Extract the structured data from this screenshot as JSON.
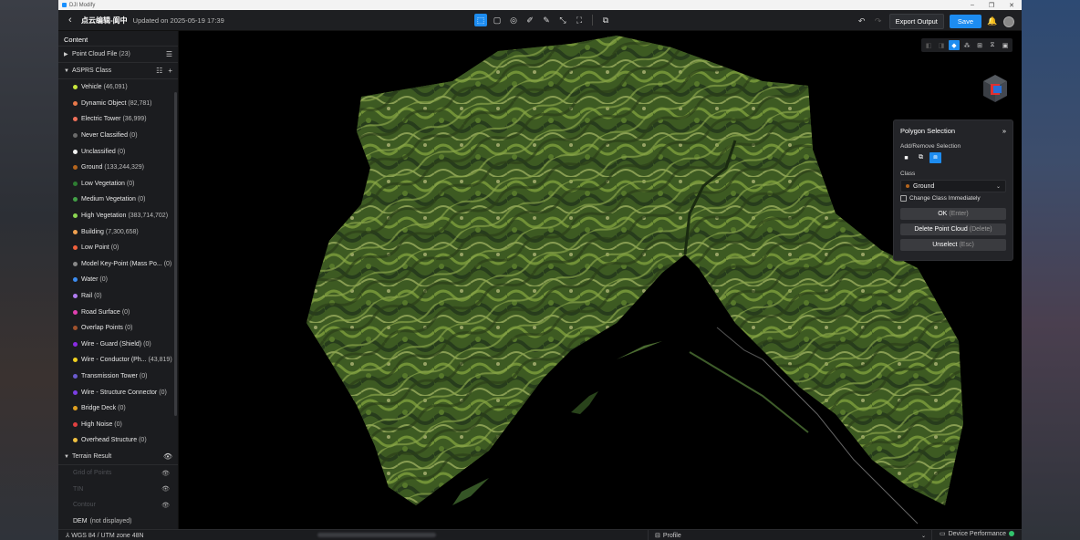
{
  "window": {
    "app_title": "DJI Modify"
  },
  "header": {
    "project_title": "点云编辑-阆中",
    "updated": "Updated on 2025-05-19 17:39",
    "export_label": "Export Output",
    "save_label": "Save"
  },
  "sidebar": {
    "title": "Content",
    "point_cloud": {
      "label": "Point Cloud File",
      "count": "(23)"
    },
    "asprs": {
      "label": "ASPRS Class"
    },
    "classes": [
      {
        "name": "Vehicle",
        "count": "(46,091)",
        "color": "#c8e63c"
      },
      {
        "name": "Dynamic Object",
        "count": "(82,781)",
        "color": "#e8784a"
      },
      {
        "name": "Electric Tower",
        "count": "(36,999)",
        "color": "#f0705a"
      },
      {
        "name": "Never Classified",
        "count": "(0)",
        "color": "#6a6a6a"
      },
      {
        "name": "Unclassified",
        "count": "(0)",
        "color": "#f0f0f0"
      },
      {
        "name": "Ground",
        "count": "(133,244,329)",
        "color": "#b5651d"
      },
      {
        "name": "Low Vegetation",
        "count": "(0)",
        "color": "#2e7d32"
      },
      {
        "name": "Medium Vegetation",
        "count": "(0)",
        "color": "#43a047"
      },
      {
        "name": "High Vegetation",
        "count": "(383,714,702)",
        "color": "#8bd651"
      },
      {
        "name": "Building",
        "count": "(7,300,658)",
        "color": "#f0a050"
      },
      {
        "name": "Low Point",
        "count": "(0)",
        "color": "#f0603c"
      },
      {
        "name": "Model Key-Point (Mass Po...",
        "count": "(0)",
        "color": "#888888"
      },
      {
        "name": "Water",
        "count": "(0)",
        "color": "#3c8cf0"
      },
      {
        "name": "Rail",
        "count": "(0)",
        "color": "#b07cf0"
      },
      {
        "name": "Road Surface",
        "count": "(0)",
        "color": "#e040b0"
      },
      {
        "name": "Overlap Points",
        "count": "(0)",
        "color": "#a0522d"
      },
      {
        "name": "Wire - Guard (Shield)",
        "count": "(0)",
        "color": "#8a2be2"
      },
      {
        "name": "Wire - Conductor (Ph...",
        "count": "(43,819)",
        "color": "#f0d020"
      },
      {
        "name": "Transmission Tower",
        "count": "(0)",
        "color": "#6a5acd"
      },
      {
        "name": "Wire - Structure Connector",
        "count": "(0)",
        "color": "#7b3fe4"
      },
      {
        "name": "Bridge Deck",
        "count": "(0)",
        "color": "#e0a020"
      },
      {
        "name": "High Noise",
        "count": "(0)",
        "color": "#e04040"
      },
      {
        "name": "Overhead Structure",
        "count": "(0)",
        "color": "#f0c040"
      }
    ],
    "terrain": {
      "label": "Terrain Result",
      "items": [
        "Grid of Points",
        "TIN",
        "Contour"
      ],
      "dem": "DEM",
      "dem_note": "(not displayed)"
    }
  },
  "panel": {
    "title": "Polygon Selection",
    "add_remove_label": "Add/Remove Selection",
    "class_label": "Class",
    "class_value": "Ground",
    "class_color": "#b5651d",
    "change_immediately": "Change Class Immediately",
    "ok": "OK",
    "ok_hint": "(Enter)",
    "delete": "Delete Point Cloud",
    "delete_hint": "(Delete)",
    "unselect": "Unselect",
    "unselect_hint": "(Esc)"
  },
  "status": {
    "crs": "WGS 84 / UTM zone 48N",
    "profile": "Profile",
    "device": "Device Performance"
  }
}
